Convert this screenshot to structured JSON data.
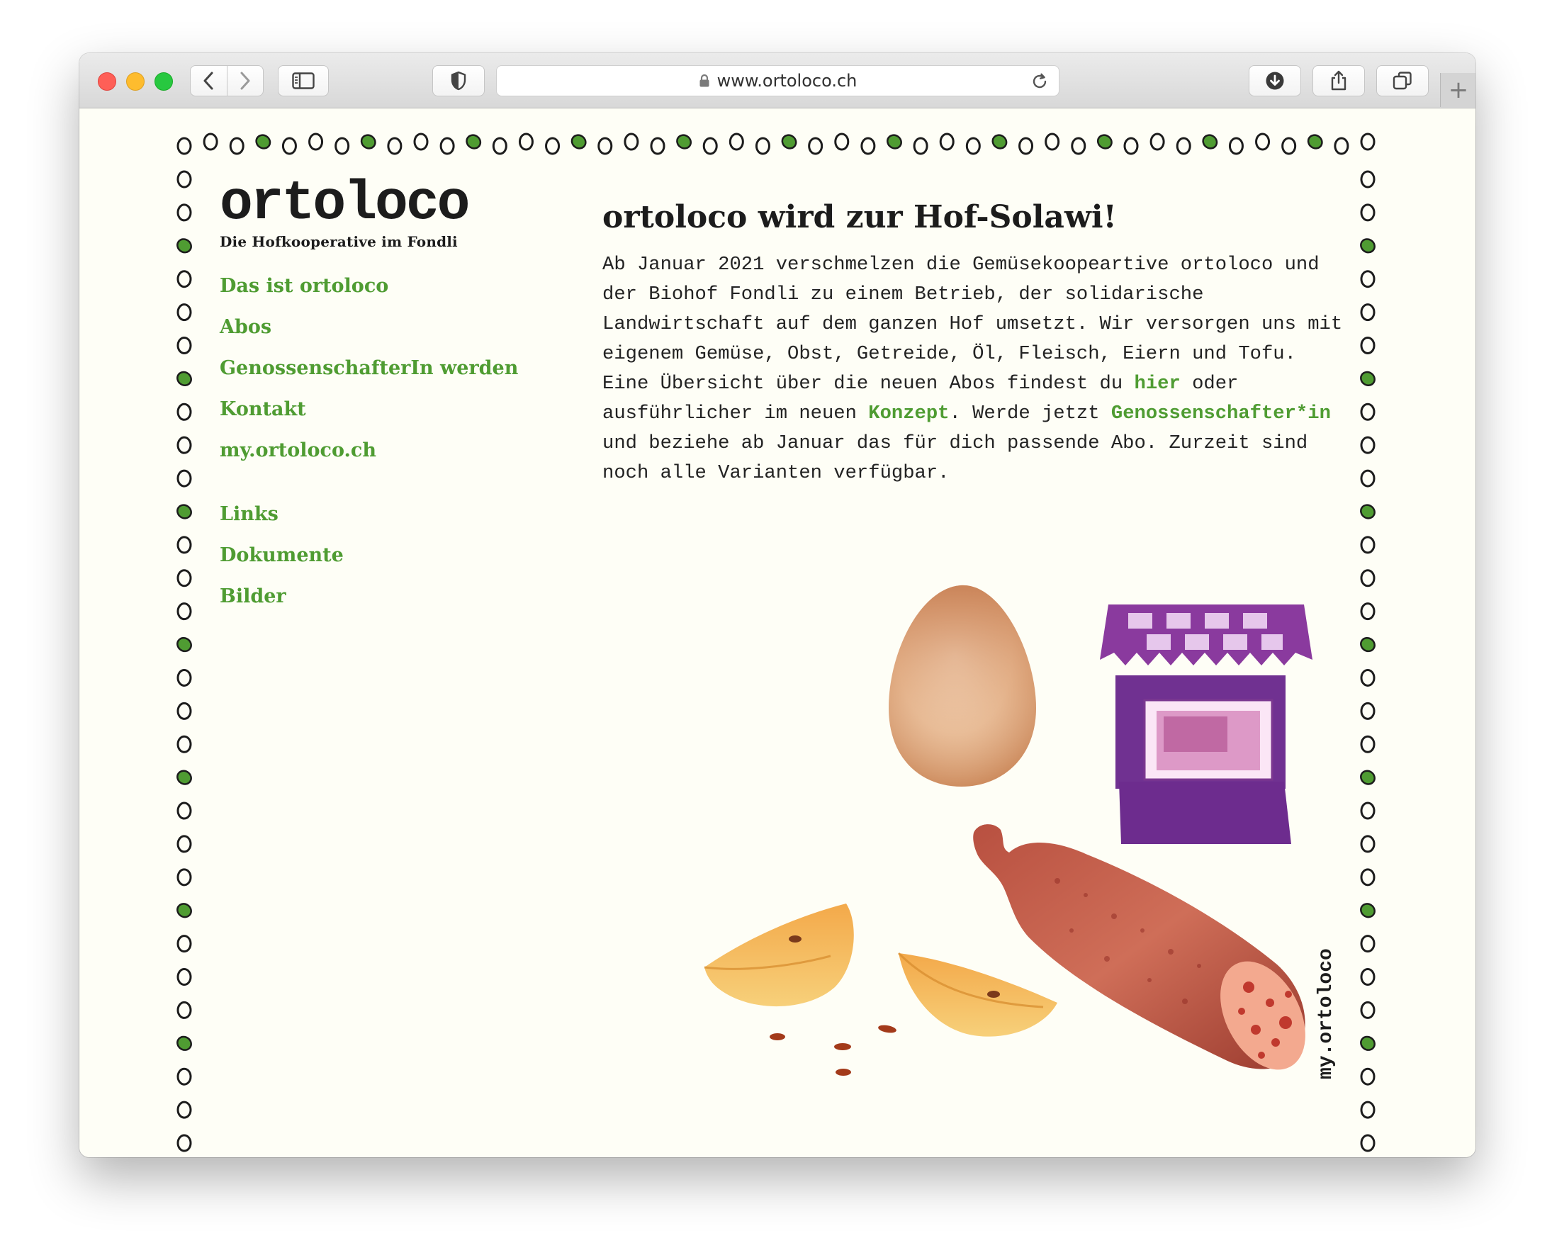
{
  "browser": {
    "url": "www.ortoloco.ch"
  },
  "site": {
    "logo_title": "ortoloco",
    "logo_subtitle": "Die Hofkooperative im Fondli",
    "nav": [
      {
        "label": "Das ist ortoloco"
      },
      {
        "label": "Abos"
      },
      {
        "label": "GenossenschafterIn werden"
      },
      {
        "label": "Kontakt"
      },
      {
        "label": "my.ortoloco.ch"
      }
    ],
    "subnav": [
      {
        "label": "Links"
      },
      {
        "label": "Dokumente"
      },
      {
        "label": "Bilder"
      }
    ],
    "side_label": "my.ortoloco"
  },
  "article": {
    "headline": "ortoloco wird zur Hof-Solawi!",
    "text_1": "Ab Januar 2021 verschmelzen die Gemüsekoopeartive ortoloco und der Biohof Fondli zu einem Betrieb, der solidarische Landwirtschaft auf dem ganzen Hof umsetzt. Wir versorgen uns mit eigenem Gemüse, Obst, Getreide, Öl, Fleisch, Eiern und Tofu. Eine Übersicht über die neuen Abos findest du ",
    "link_hier": "hier",
    "text_2": " oder ausführlicher im neuen ",
    "link_konzept": "Konzept",
    "text_3": ". Werde jetzt ",
    "link_genossenschafter": "Genossenschafter*in",
    "text_4": " und beziehe ab Januar das für dich passende Abo. Zurzeit sind noch alle Varianten verfügbar."
  },
  "colors": {
    "accent_green": "#4f9c32",
    "page_background": "#fefef6",
    "text_dark": "#1c1c1c"
  },
  "icons": {
    "border_beads": "bead-ring-icon",
    "illustrations": [
      "egg-illustration",
      "jam-jar-illustration",
      "sausage-illustration",
      "apple-slices-illustration"
    ]
  }
}
